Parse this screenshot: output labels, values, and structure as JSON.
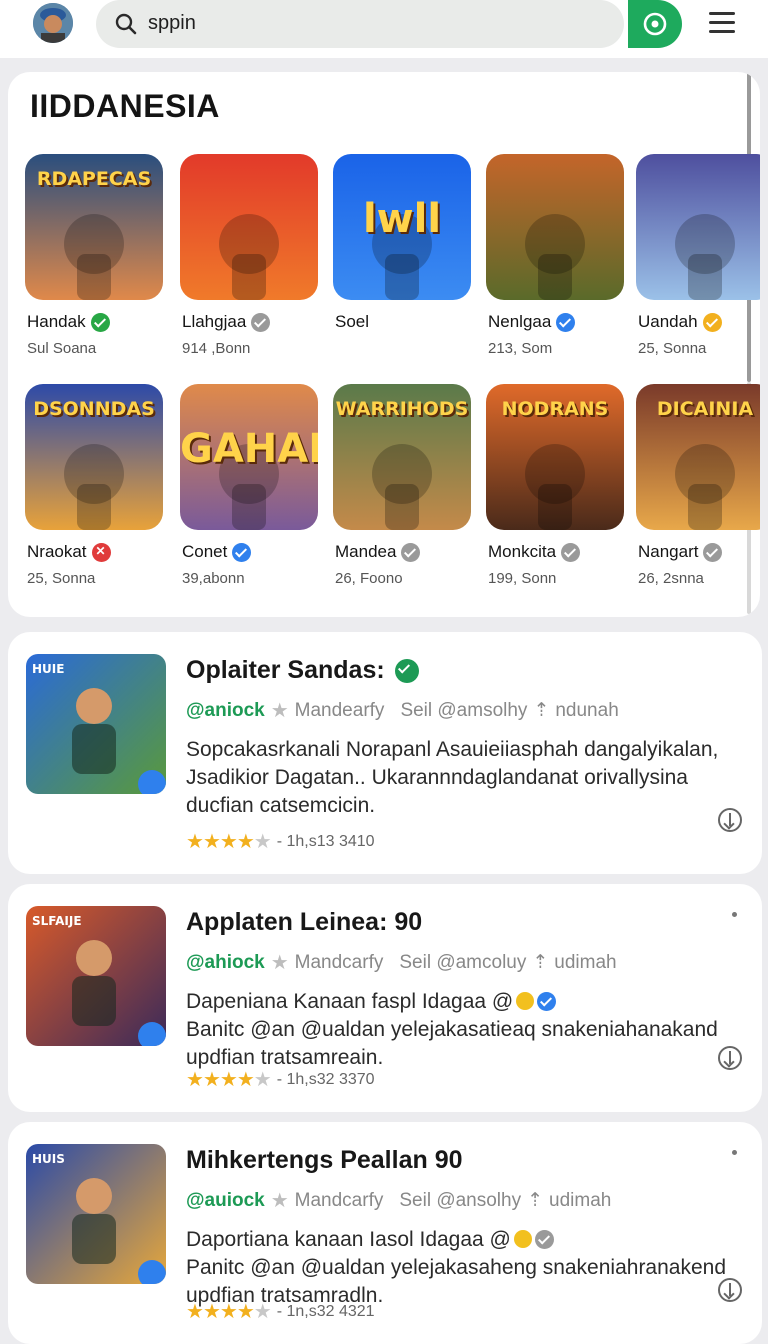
{
  "search": {
    "value": "sppin"
  },
  "section": {
    "title": "IIDDANESIA"
  },
  "grid_apps": [
    {
      "name": "Handak",
      "meta": "Sul Soana",
      "badge_color": "#28a745",
      "badge_type": "check",
      "icon_text": "RDAPECAS",
      "icon_colors": [
        "#2a4e7e",
        "#e0894a"
      ]
    },
    {
      "name": "Llahgjaa",
      "meta": "914 ,Bonn",
      "badge_color": "#9a9a9a",
      "badge_type": "plus",
      "icon_text": "",
      "icon_colors": [
        "#e23a2a",
        "#f07a2a"
      ]
    },
    {
      "name": "Soel",
      "meta": "",
      "badge_color": "",
      "badge_type": "none",
      "icon_text": "lwll",
      "icon_colors": [
        "#1a63e8",
        "#3c8cf2"
      ]
    },
    {
      "name": "Nenlgaa",
      "meta": "213, Som",
      "badge_color": "#2f80ed",
      "badge_type": "check",
      "icon_text": "",
      "icon_colors": [
        "#c4652a",
        "#5a6a2a"
      ]
    },
    {
      "name": "Uandah",
      "meta": "25, Sonna",
      "badge_color": "#f2b01e",
      "badge_type": "star",
      "icon_text": "",
      "icon_colors": [
        "#4e4f9e",
        "#9bc1e8"
      ]
    },
    {
      "name": "Nraokat",
      "meta": "25, Sonna",
      "badge_color": "#e03b3b",
      "badge_type": "x",
      "icon_text": "DSONNDAS",
      "icon_colors": [
        "#2d4aa8",
        "#e8a23a"
      ]
    },
    {
      "name": "Conet",
      "meta": "39,abonn",
      "badge_color": "#2f80ed",
      "badge_type": "check",
      "icon_text": "GAHAE",
      "icon_colors": [
        "#e08a4a",
        "#7a5a9a"
      ]
    },
    {
      "name": "Mandea",
      "meta": "26, Foono",
      "badge_color": "#9a9a9a",
      "badge_type": "check",
      "icon_text": "WARRIHODS",
      "icon_colors": [
        "#5a7a4a",
        "#c48a4a"
      ]
    },
    {
      "name": "Monkcita",
      "meta": "199, Sonn",
      "badge_color": "#9a9a9a",
      "badge_type": "star",
      "icon_text": "NODRANS",
      "icon_colors": [
        "#e06a2a",
        "#4a2a1a"
      ]
    },
    {
      "name": "Nangart",
      "meta": "26, 2snna",
      "badge_color": "#9a9a9a",
      "badge_type": "star",
      "icon_text": "DICAINIA",
      "icon_colors": [
        "#7a3a2a",
        "#e8a84a"
      ]
    }
  ],
  "list_apps": [
    {
      "title": "Oplaiter Sandas:",
      "title_badge_color": "#1d9a55",
      "developer": "@aniock",
      "category": "Mandearfy",
      "tagline": "Seil @amsolhy",
      "tag2": "ndunah",
      "description": "Sopcakasrkanali Norapanl Asauieiiasphah dangalyikalan, Jsadikior Dagatan.. Ukarannndaglandanat orivallysina ducfian catsemcicin.",
      "rating_stars": 4,
      "rating_text": "- 1h,s13 3410",
      "thumb_label": "HUIE",
      "thumb_colors": [
        "#2a6ad8",
        "#5a9a3a"
      ]
    },
    {
      "title": "Applaten Leinea: 90",
      "title_badge_color": "",
      "developer": "@ahiock",
      "category": "Mandcarfy",
      "tagline": "Seil @amcoluy",
      "tag2": "udimah",
      "description": "Dapeniana Kanaan faspl Idagaa @",
      "description2": "Banitc @an @ualdan yelejakasatieaq snakeniahanakand updfian tratsamreain.",
      "rating_stars": 4,
      "rating_text": "- 1h,s32 3370",
      "thumb_label": "SLFAIJE",
      "thumb_colors": [
        "#d85a2a",
        "#3a2a5a"
      ]
    },
    {
      "title": "Mihkertengs Peallan 90",
      "title_badge_color": "",
      "developer": "@auiock",
      "category": "Mandcarfy",
      "tagline": "Seil @ansolhy",
      "tag2": "udimah",
      "description": "Daportiana kanaan Iasol Idagaa @",
      "description2": "Panitc @an @ualdan yelejakasaheng snakeniahranakend updfian tratsamradln.",
      "rating_stars": 4,
      "rating_text": "- 1n,s32 4321",
      "thumb_label": "HUIS",
      "thumb_colors": [
        "#2a4aa8",
        "#e8a83a"
      ]
    }
  ]
}
